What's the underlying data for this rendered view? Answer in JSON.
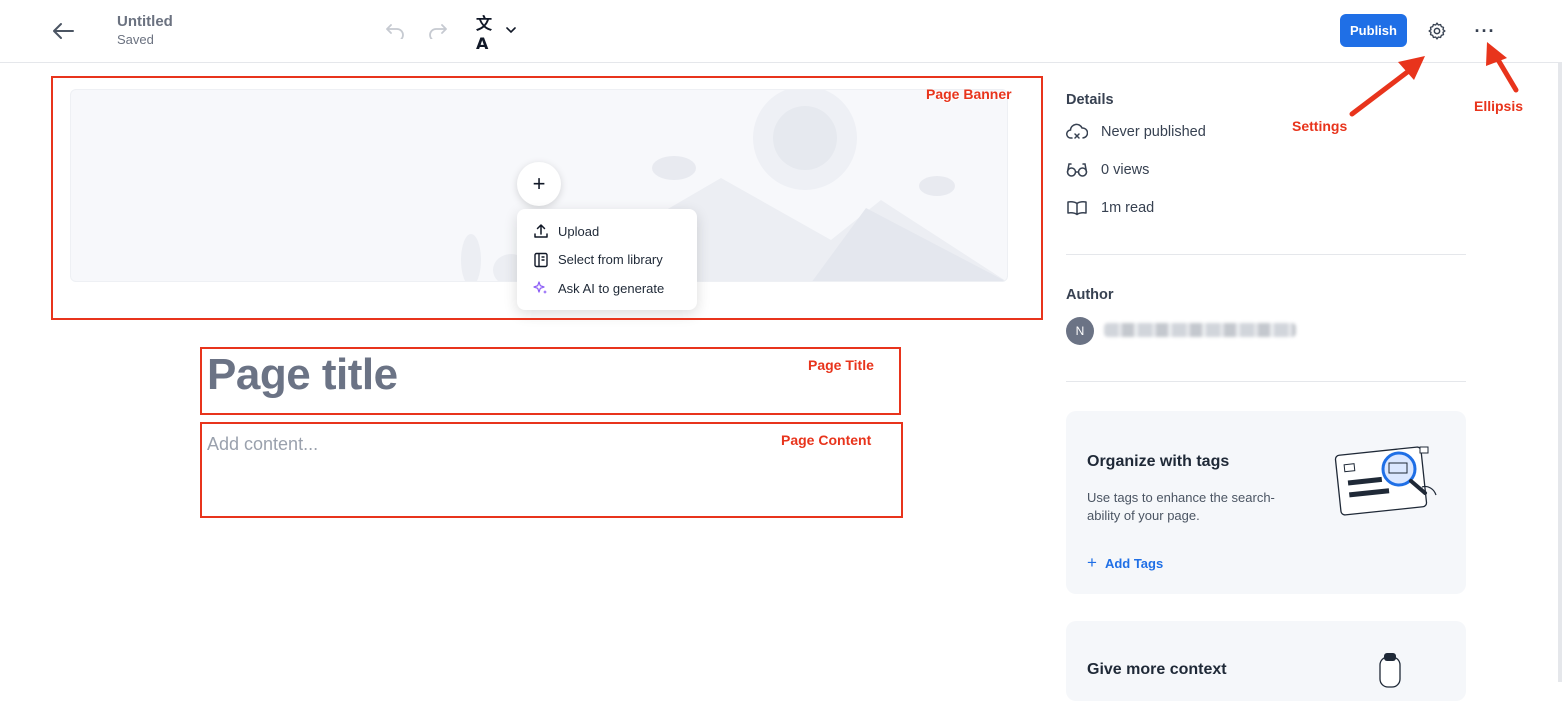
{
  "header": {
    "doc_title": "Untitled",
    "doc_status": "Saved",
    "publish_label": "Publish",
    "translate_glyph": "文A",
    "more_glyph": "···"
  },
  "banner": {
    "add_glyph": "+",
    "menu": [
      {
        "label": "Upload",
        "icon": "upload-icon"
      },
      {
        "label": "Select from library",
        "icon": "library-icon"
      },
      {
        "label": "Ask AI to generate",
        "icon": "sparkle-icon"
      }
    ]
  },
  "editor": {
    "title_placeholder": "Page title",
    "content_placeholder": "Add content..."
  },
  "details": {
    "heading": "Details",
    "published": "Never published",
    "views": "0 views",
    "read_time": "1m read"
  },
  "author": {
    "heading": "Author",
    "initial": "N"
  },
  "tags_card": {
    "title": "Organize with tags",
    "text": "Use tags to enhance the search-ability of your page.",
    "add_label": "Add Tags"
  },
  "context_card": {
    "title": "Give more context"
  },
  "annotations": {
    "banner": "Page Banner",
    "title": "Page Title",
    "content": "Page Content",
    "settings": "Settings",
    "ellipsis": "Ellipsis"
  },
  "colors": {
    "accent": "#1f6fe6",
    "annotation": "#e8341c"
  }
}
